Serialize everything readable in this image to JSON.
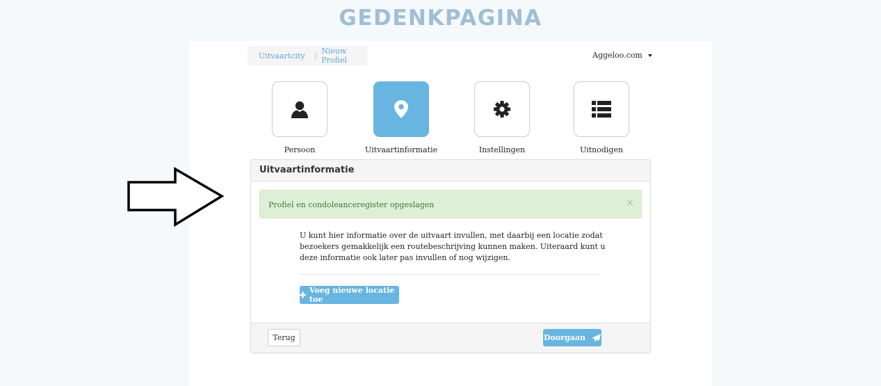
{
  "page": {
    "title": "GEDENKPAGINA"
  },
  "breadcrumb": {
    "home": "Uitvaartcity",
    "separator": "/",
    "current": "Nieuw Profiel"
  },
  "site_menu": {
    "label": "Aggeloo.com"
  },
  "steps": [
    {
      "label": "Persoon",
      "icon": "user-icon",
      "active": false
    },
    {
      "label": "Uitvaartinformatie",
      "icon": "map-marker-icon",
      "active": true
    },
    {
      "label": "Instellingen",
      "icon": "gear-icon",
      "active": false
    },
    {
      "label": "Uitnodigen",
      "icon": "list-icon",
      "active": false
    }
  ],
  "panel": {
    "heading": "Uitvaartinformatie",
    "alert": {
      "text": "Profiel en condoleanceregister opgeslagen",
      "close": "×"
    },
    "intro": "U kunt hier informatie over de uitvaart invullen, met daarbij een locatie zodat bezoekers gemakkelijk een routebeschrijving kunnen maken. Uiteraard kunt u deze informatie ook later pas invullen of nog wijzigen.",
    "add_button": "Voeg nieuwe locatie toe",
    "back_button": "Terug",
    "next_button": "Doorgaan"
  },
  "colors": {
    "accent": "#67b5e0",
    "title": "#a0bfd4",
    "alert_bg": "#dff0d8",
    "alert_text": "#3c763d"
  }
}
